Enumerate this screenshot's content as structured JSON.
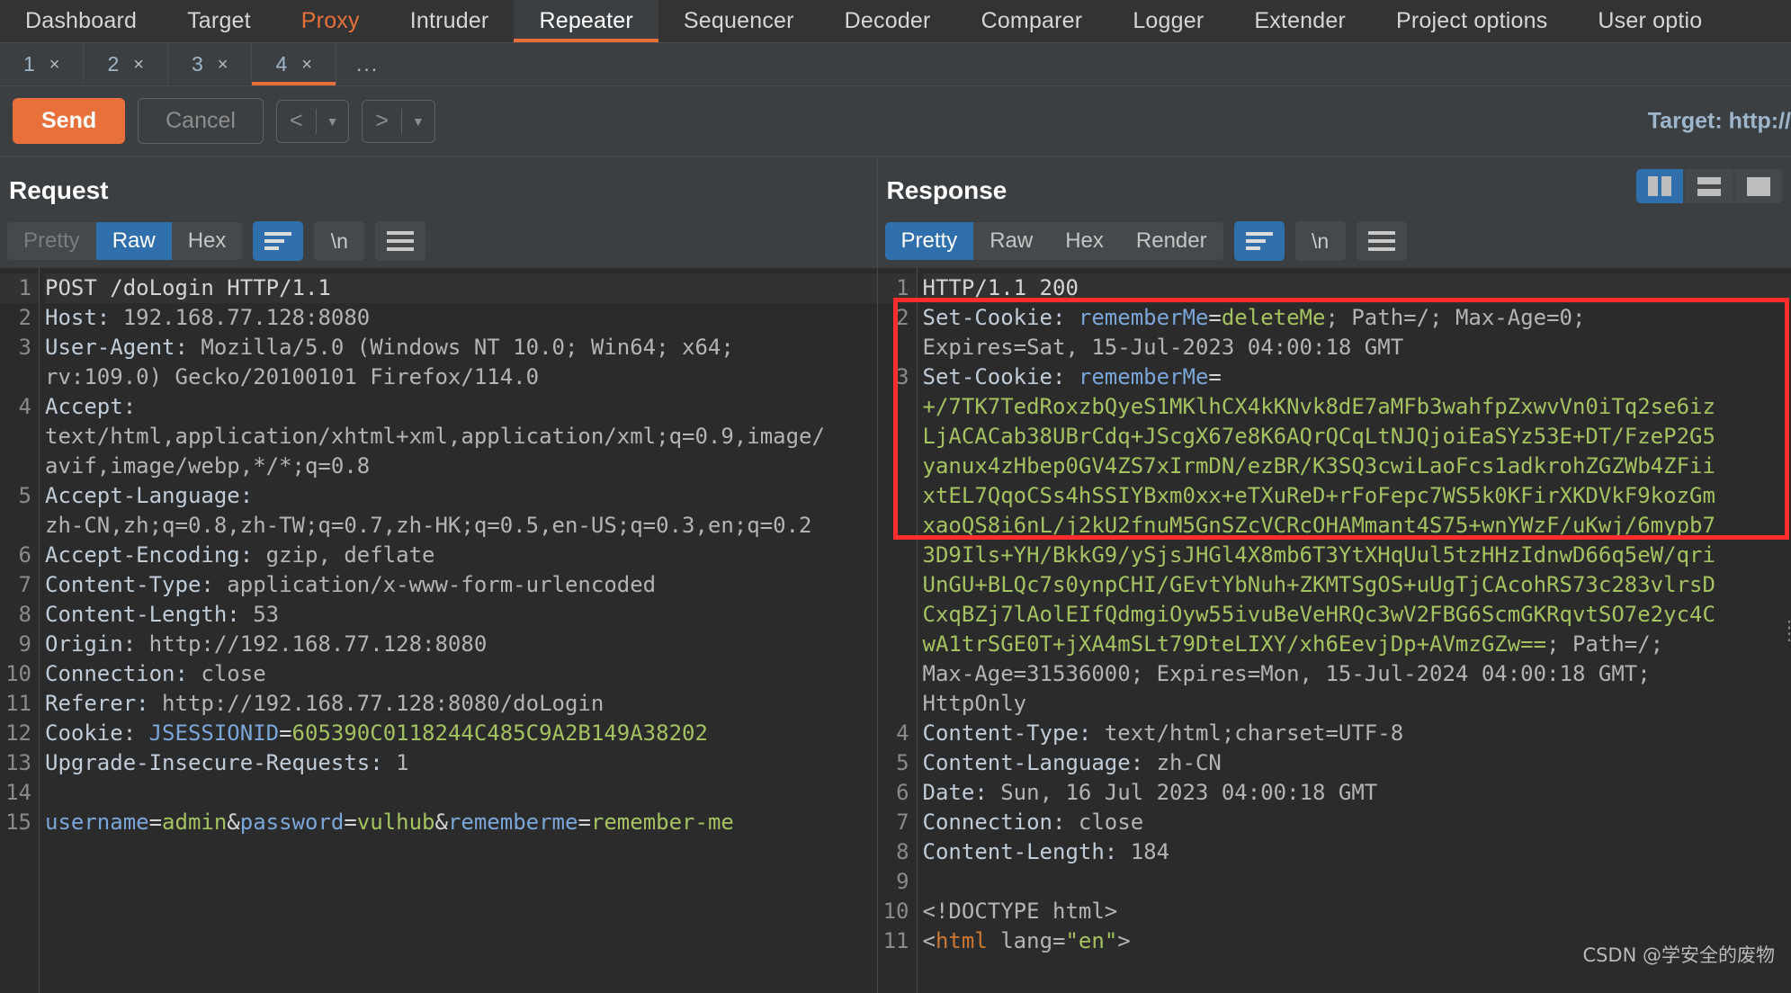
{
  "main_tabs": [
    {
      "label": "Dashboard",
      "state": "normal"
    },
    {
      "label": "Target",
      "state": "normal"
    },
    {
      "label": "Proxy",
      "state": "accent"
    },
    {
      "label": "Intruder",
      "state": "normal"
    },
    {
      "label": "Repeater",
      "state": "selected"
    },
    {
      "label": "Sequencer",
      "state": "normal"
    },
    {
      "label": "Decoder",
      "state": "normal"
    },
    {
      "label": "Comparer",
      "state": "normal"
    },
    {
      "label": "Logger",
      "state": "normal"
    },
    {
      "label": "Extender",
      "state": "normal"
    },
    {
      "label": "Project options",
      "state": "normal"
    },
    {
      "label": "User optio",
      "state": "normal"
    }
  ],
  "sub_tabs": [
    {
      "label": "1",
      "close": "×",
      "selected": false
    },
    {
      "label": "2",
      "close": "×",
      "selected": false
    },
    {
      "label": "3",
      "close": "×",
      "selected": false
    },
    {
      "label": "4",
      "close": "×",
      "selected": true
    }
  ],
  "sub_tabs_more": "...",
  "toolbar": {
    "send_label": "Send",
    "cancel_label": "Cancel",
    "back_glyph": "<",
    "forward_glyph": ">",
    "caret_glyph": "▼",
    "target_label": "Target: http://"
  },
  "request": {
    "title": "Request",
    "tabs": [
      {
        "label": "Pretty",
        "state": "disabled"
      },
      {
        "label": "Raw",
        "state": "active"
      },
      {
        "label": "Hex",
        "state": "normal"
      }
    ],
    "wrap_button": "wrap-lines-icon",
    "newline_button": "\\n",
    "menu_button": "hamburger-icon",
    "lines": [
      {
        "num": "1",
        "highlight": true,
        "spans": [
          {
            "t": "POST /doLogin HTTP/1.1",
            "c": "k-white"
          }
        ]
      },
      {
        "num": "2",
        "spans": [
          {
            "t": "Host: ",
            "c": "k-hdr"
          },
          {
            "t": "192.168.77.128:8080",
            "c": "k-val"
          }
        ]
      },
      {
        "num": "3",
        "spans": [
          {
            "t": "User-Agent: ",
            "c": "k-hdr"
          },
          {
            "t": "Mozilla/5.0 (Windows NT 10.0; Win64; x64;",
            "c": "k-val"
          }
        ]
      },
      {
        "num": "",
        "spans": [
          {
            "t": "rv:109.0) Gecko/20100101 Firefox/114.0",
            "c": "k-val"
          }
        ]
      },
      {
        "num": "4",
        "spans": [
          {
            "t": "Accept: ",
            "c": "k-hdr"
          }
        ]
      },
      {
        "num": "",
        "spans": [
          {
            "t": "text/html,application/xhtml+xml,application/xml;q=0.9,image/",
            "c": "k-val"
          }
        ]
      },
      {
        "num": "",
        "spans": [
          {
            "t": "avif,image/webp,*/*;q=0.8",
            "c": "k-val"
          }
        ]
      },
      {
        "num": "5",
        "spans": [
          {
            "t": "Accept-Language: ",
            "c": "k-hdr"
          }
        ]
      },
      {
        "num": "",
        "spans": [
          {
            "t": "zh-CN,zh;q=0.8,zh-TW;q=0.7,zh-HK;q=0.5,en-US;q=0.3,en;q=0.2",
            "c": "k-val"
          }
        ]
      },
      {
        "num": "6",
        "spans": [
          {
            "t": "Accept-Encoding: ",
            "c": "k-hdr"
          },
          {
            "t": "gzip, deflate",
            "c": "k-val"
          }
        ]
      },
      {
        "num": "7",
        "spans": [
          {
            "t": "Content-Type: ",
            "c": "k-hdr"
          },
          {
            "t": "application/x-www-form-urlencoded",
            "c": "k-val"
          }
        ]
      },
      {
        "num": "8",
        "spans": [
          {
            "t": "Content-Length: ",
            "c": "k-hdr"
          },
          {
            "t": "53",
            "c": "k-val"
          }
        ]
      },
      {
        "num": "9",
        "spans": [
          {
            "t": "Origin: ",
            "c": "k-hdr"
          },
          {
            "t": "http://192.168.77.128:8080",
            "c": "k-val"
          }
        ]
      },
      {
        "num": "10",
        "spans": [
          {
            "t": "Connection: ",
            "c": "k-hdr"
          },
          {
            "t": "close",
            "c": "k-val"
          }
        ]
      },
      {
        "num": "11",
        "spans": [
          {
            "t": "Referer: ",
            "c": "k-hdr"
          },
          {
            "t": "http://192.168.77.128:8080/doLogin",
            "c": "k-val"
          }
        ]
      },
      {
        "num": "12",
        "spans": [
          {
            "t": "Cookie: ",
            "c": "k-hdr"
          },
          {
            "t": "JSESSIONID",
            "c": "k-name"
          },
          {
            "t": "=",
            "c": "k-white"
          },
          {
            "t": "605390C0118244C485C9A2B149A38202",
            "c": "k-green"
          }
        ]
      },
      {
        "num": "13",
        "spans": [
          {
            "t": "Upgrade-Insecure-Requests: ",
            "c": "k-hdr"
          },
          {
            "t": "1",
            "c": "k-val"
          }
        ]
      },
      {
        "num": "14",
        "spans": [
          {
            "t": "",
            "c": "k-white"
          }
        ]
      },
      {
        "num": "15",
        "spans": [
          {
            "t": "username",
            "c": "k-name"
          },
          {
            "t": "=",
            "c": "k-white"
          },
          {
            "t": "admin",
            "c": "k-green"
          },
          {
            "t": "&",
            "c": "k-white"
          },
          {
            "t": "password",
            "c": "k-name"
          },
          {
            "t": "=",
            "c": "k-white"
          },
          {
            "t": "vulhub",
            "c": "k-green"
          },
          {
            "t": "&",
            "c": "k-white"
          },
          {
            "t": "rememberme",
            "c": "k-name"
          },
          {
            "t": "=",
            "c": "k-white"
          },
          {
            "t": "remember-me",
            "c": "k-green"
          }
        ]
      }
    ]
  },
  "response": {
    "title": "Response",
    "tabs": [
      {
        "label": "Pretty",
        "state": "active"
      },
      {
        "label": "Raw",
        "state": "normal"
      },
      {
        "label": "Hex",
        "state": "normal"
      },
      {
        "label": "Render",
        "state": "normal"
      }
    ],
    "wrap_button": "wrap-lines-icon",
    "newline_button": "\\n",
    "menu_button": "hamburger-icon",
    "view_toggles": [
      {
        "name": "side-by-side-view",
        "active": true
      },
      {
        "name": "stacked-view",
        "active": false
      },
      {
        "name": "single-view",
        "active": false
      }
    ],
    "lines": [
      {
        "num": "1",
        "highlight": true,
        "spans": [
          {
            "t": "HTTP/1.1 200",
            "c": "k-white"
          }
        ]
      },
      {
        "num": "2",
        "spans": [
          {
            "t": "Set-Cookie: ",
            "c": "k-hdr"
          },
          {
            "t": "rememberMe",
            "c": "k-name"
          },
          {
            "t": "=",
            "c": "k-white"
          },
          {
            "t": "deleteMe",
            "c": "k-green"
          },
          {
            "t": "; Path=/; Max-Age=0;",
            "c": "k-val"
          }
        ]
      },
      {
        "num": "",
        "spans": [
          {
            "t": "Expires=Sat, 15-Jul-2023 04:00:18 GMT",
            "c": "k-val"
          }
        ]
      },
      {
        "num": "3",
        "spans": [
          {
            "t": "Set-Cookie: ",
            "c": "k-hdr"
          },
          {
            "t": "rememberMe",
            "c": "k-name"
          },
          {
            "t": "=",
            "c": "k-white"
          }
        ]
      },
      {
        "num": "",
        "spans": [
          {
            "t": "+/7TK7TedRoxzbQyeS1MKlhCX4kKNvk8dE7aMFb3wahfpZxwvVn0iTq2se6iz",
            "c": "k-green"
          }
        ]
      },
      {
        "num": "",
        "spans": [
          {
            "t": "LjACACab38UBrCdq+JScgX67e8K6AQrQCqLtNJQjoiEaSYz53E+DT/FzeP2G5",
            "c": "k-green"
          }
        ]
      },
      {
        "num": "",
        "spans": [
          {
            "t": "yanux4zHbep0GV4ZS7xIrmDN/ezBR/K3SQ3cwiLaoFcs1adkrohZGZWb4ZFii",
            "c": "k-green"
          }
        ]
      },
      {
        "num": "",
        "spans": [
          {
            "t": "xtEL7QqoCSs4hSSIYBxm0xx+eTXuReD+rFoFepc7WS5k0KFirXKDVkF9kozGm",
            "c": "k-green"
          }
        ]
      },
      {
        "num": "",
        "spans": [
          {
            "t": "xaoQS8i6nL/j2kU2fnuM5GnSZcVCRcOHAMmant4S75+wnYWzF/uKwj/6mypb7",
            "c": "k-green"
          }
        ]
      },
      {
        "num": "",
        "spans": [
          {
            "t": "3D9Ils+YH/BkkG9/ySjsJHGl4X8mb6T3YtXHqUul5tzHHzIdnwD66q5eW/qri",
            "c": "k-green"
          }
        ]
      },
      {
        "num": "",
        "spans": [
          {
            "t": "UnGU+BLQc7s0ynpCHI/GEvtYbNuh+ZKMTSgOS+uUgTjCAcohRS73c283vlrsD",
            "c": "k-green"
          }
        ]
      },
      {
        "num": "",
        "spans": [
          {
            "t": "CxqBZj7lAolEIfQdmgiOyw55ivuBeVeHRQc3wV2FBG6ScmGKRqvtSO7e2yc4C",
            "c": "k-green"
          }
        ]
      },
      {
        "num": "",
        "spans": [
          {
            "t": "wA1trSGE0T+jXA4mSLt79DteLIXY/xh6EevjDp+AVmzGZw==",
            "c": "k-green"
          },
          {
            "t": "; Path=/;",
            "c": "k-val"
          }
        ]
      },
      {
        "num": "",
        "spans": [
          {
            "t": "Max-Age=31536000; Expires=Mon, 15-Jul-2024 04:00:18 GMT;",
            "c": "k-val"
          }
        ]
      },
      {
        "num": "",
        "spans": [
          {
            "t": "HttpOnly",
            "c": "k-val"
          }
        ]
      },
      {
        "num": "4",
        "spans": [
          {
            "t": "Content-Type: ",
            "c": "k-hdr"
          },
          {
            "t": "text/html;charset=UTF-8",
            "c": "k-val"
          }
        ]
      },
      {
        "num": "5",
        "spans": [
          {
            "t": "Content-Language: ",
            "c": "k-hdr"
          },
          {
            "t": "zh-CN",
            "c": "k-val"
          }
        ]
      },
      {
        "num": "6",
        "spans": [
          {
            "t": "Date: ",
            "c": "k-hdr"
          },
          {
            "t": "Sun, 16 Jul 2023 04:00:18 GMT",
            "c": "k-val"
          }
        ]
      },
      {
        "num": "7",
        "spans": [
          {
            "t": "Connection: ",
            "c": "k-hdr"
          },
          {
            "t": "close",
            "c": "k-val"
          }
        ]
      },
      {
        "num": "8",
        "spans": [
          {
            "t": "Content-Length: ",
            "c": "k-hdr"
          },
          {
            "t": "184",
            "c": "k-val"
          }
        ]
      },
      {
        "num": "9",
        "spans": [
          {
            "t": "",
            "c": "k-white"
          }
        ]
      },
      {
        "num": "10",
        "spans": [
          {
            "t": "<!DOCTYPE html>",
            "c": "k-val"
          }
        ]
      },
      {
        "num": "11",
        "spans": [
          {
            "t": "<",
            "c": "k-val"
          },
          {
            "t": "html",
            "c": "k-orange"
          },
          {
            "t": " lang=",
            "c": "k-val"
          },
          {
            "t": "\"en\"",
            "c": "k-green"
          },
          {
            "t": ">",
            "c": "k-val"
          }
        ]
      }
    ]
  },
  "annotation": {
    "box_color": "#ff2d2d"
  },
  "watermark": "CSDN @学安全的废物"
}
